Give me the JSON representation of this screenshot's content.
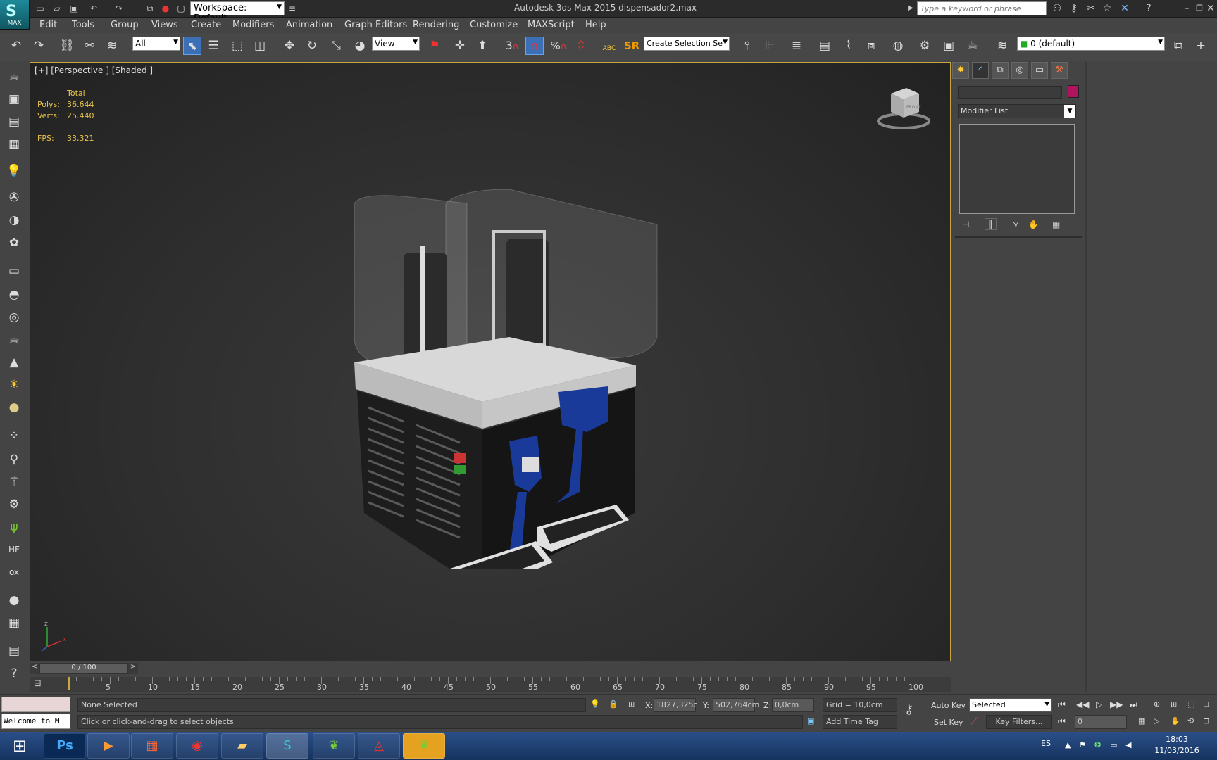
{
  "app": {
    "logo_text": "MAX",
    "workspace": "Workspace: Default",
    "title": "Autodesk 3ds Max  2015    dispensador2.max",
    "search_placeholder": "Type a keyword or phrase"
  },
  "menu": [
    "Edit",
    "Tools",
    "Group",
    "Views",
    "Create",
    "Modifiers",
    "Animation",
    "Graph Editors",
    "Rendering",
    "Customize",
    "MAXScript",
    "Help"
  ],
  "toolbar": {
    "selection_filter": "All",
    "ref_coord": "View",
    "snap_toggle": "3",
    "spinner_percent": "%",
    "spell_label": "ABC",
    "sr_label": "SR",
    "named_selection": "Create Selection Se",
    "layer": "0 (default)"
  },
  "viewport": {
    "label": "[+] [Perspective ] [Shaded ]",
    "stats_header": "Total",
    "polys_label": "Polys:",
    "polys_value": "36.644",
    "verts_label": "Verts:",
    "verts_value": "25.440",
    "fps_label": "FPS:",
    "fps_value": "33,321",
    "gizmo_x": "x",
    "gizmo_z": "z",
    "viewcube_label": "FRONT"
  },
  "command_panel": {
    "modifier_list": "Modifier List",
    "object_color": "#b0145e"
  },
  "timeline": {
    "frame_display": "0 / 100",
    "prev": "<",
    "next": ">",
    "ticks": [
      "5",
      "10",
      "15",
      "20",
      "25",
      "30",
      "35",
      "40",
      "45",
      "50",
      "55",
      "60",
      "65",
      "70",
      "75",
      "80",
      "85",
      "90",
      "95",
      "100"
    ]
  },
  "status": {
    "maxscript": "Welcome to M",
    "selection": "None Selected",
    "prompt": "Click or click-and-drag to select objects",
    "x_label": "X:",
    "x_value": "1827,325c",
    "y_label": "Y:",
    "y_value": "502,764cm",
    "z_label": "Z:",
    "z_value": "0,0cm",
    "grid": "Grid = 10,0cm",
    "add_time_tag": "Add Time Tag",
    "auto_key": "Auto Key",
    "set_key": "Set Key",
    "key_mode": "Selected",
    "key_filters": "Key Filters...",
    "frame": "0"
  },
  "taskbar": {
    "lang": "ES",
    "time": "18:03",
    "date": "11/03/2016",
    "apps": [
      "start",
      "photoshop",
      "media",
      "apps",
      "chrome",
      "explorer",
      "3dsmax",
      "corel1",
      "acrobat",
      "corel2"
    ]
  }
}
